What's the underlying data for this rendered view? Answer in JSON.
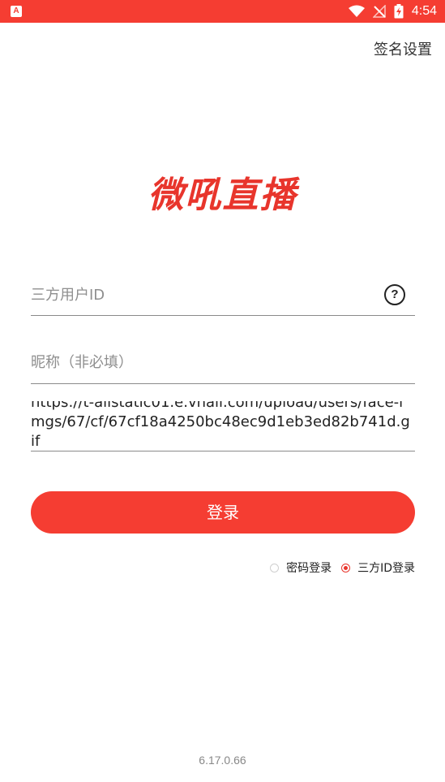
{
  "status_bar": {
    "time": "4:54",
    "app_badge": "A",
    "icons": [
      "wifi-icon",
      "no-signal-icon",
      "battery-icon"
    ],
    "background": "#f53d32"
  },
  "header": {
    "sign_settings_label": "签名设置"
  },
  "logo": {
    "text": "微吼直播",
    "color": "#e8352c"
  },
  "form": {
    "third_party_id": {
      "placeholder": "三方用户ID",
      "value": ""
    },
    "nickname": {
      "placeholder": "昵称（非必填）",
      "value": ""
    },
    "avatar_url": {
      "value": "https://t-alistatic01.e.vhall.com/upload/users/face-imgs/67/cf/67cf18a4250bc48ec9d1eb3ed82b741d.gif"
    },
    "login_button_label": "登录",
    "login_modes": [
      {
        "label": "密码登录",
        "checked": false
      },
      {
        "label": "三方ID登录",
        "checked": true
      }
    ]
  },
  "footer": {
    "version": "6.17.0.66"
  },
  "colors": {
    "accent": "#f53d32",
    "logo": "#e8352c"
  }
}
